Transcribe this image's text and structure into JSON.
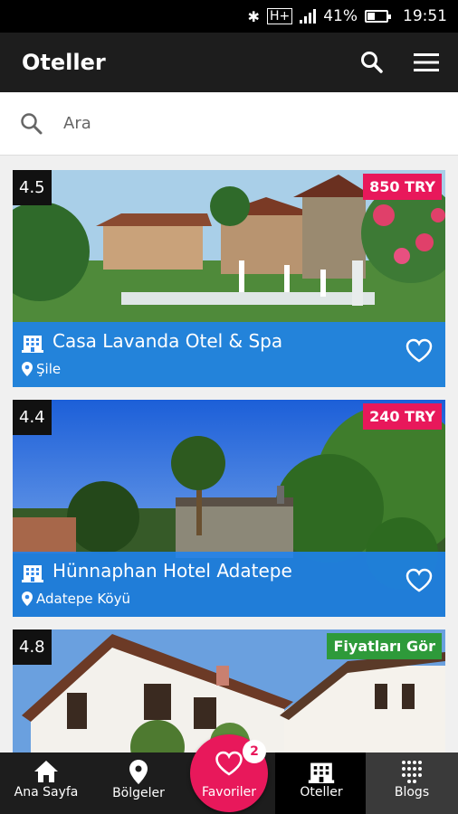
{
  "status_bar": {
    "battery": "41%",
    "battery_level": 0.41,
    "time": "19:51",
    "network": "H+"
  },
  "app_bar": {
    "title": "Oteller",
    "search_icon": "search-icon",
    "menu_icon": "menu-icon"
  },
  "search": {
    "placeholder": "Ara",
    "value": ""
  },
  "hotels": [
    {
      "rating": "4.5",
      "price": "850 TRY",
      "name": "Casa Lavanda Otel & Spa",
      "location": "Şile",
      "favorite": false
    },
    {
      "rating": "4.4",
      "price": "240 TRY",
      "name": "Hünnaphan Hotel Adatepe",
      "location": "Adatepe Köyü",
      "favorite": false
    },
    {
      "rating": "4.8",
      "price": "Fiyatları Gör",
      "name": "",
      "location": "",
      "favorite": false
    }
  ],
  "bottom_nav": {
    "home": "Ana Sayfa",
    "regions": "Bölgeler",
    "favorites": "Favoriler",
    "favorites_count": "2",
    "hotels": "Oteller",
    "blogs": "Blogs",
    "active": "hotels"
  },
  "colors": {
    "accent": "#e8185b",
    "info_bar": "#1e82f0",
    "app_bar": "#1d1d1d",
    "price_green": "#2e9a3a"
  }
}
